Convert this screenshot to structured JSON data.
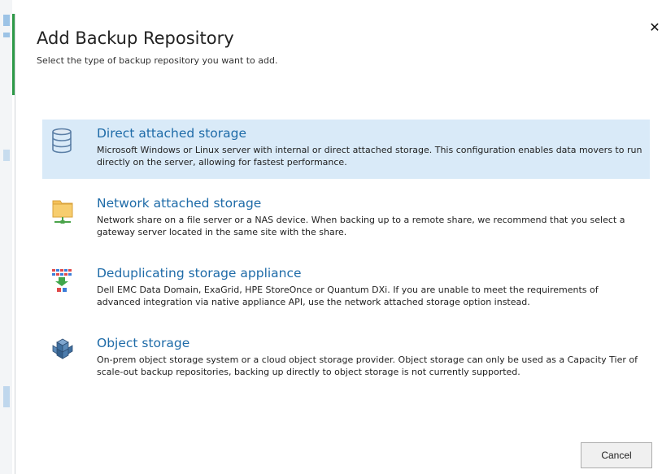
{
  "dialog": {
    "title": "Add Backup Repository",
    "subtitle": "Select the type of backup repository you want to add.",
    "close_glyph": "✕"
  },
  "options": [
    {
      "title": "Direct attached storage",
      "description": "Microsoft Windows or Linux server with internal or direct attached storage. This configuration enables data movers to run directly on the server, allowing for fastest performance.",
      "icon": "database-disk-icon",
      "selected": true
    },
    {
      "title": "Network attached storage",
      "description": "Network share on a file server or a NAS device. When backing up to a remote share, we recommend that you select a gateway server located in the same site with the share.",
      "icon": "network-folder-icon",
      "selected": false
    },
    {
      "title": "Deduplicating storage appliance",
      "description": "Dell EMC Data Domain, ExaGrid, HPE StoreOnce or Quantum DXi. If you are unable to meet the requirements of advanced integration via native appliance API, use the network attached storage option instead.",
      "icon": "dedup-appliance-icon",
      "selected": false
    },
    {
      "title": "Object storage",
      "description": "On-prem object storage system or a cloud object storage provider. Object storage can only be used as a Capacity Tier of scale-out backup repositories, backing up directly to object storage is not currently supported.",
      "icon": "object-storage-cubes-icon",
      "selected": false
    }
  ],
  "footer": {
    "cancel_label": "Cancel"
  },
  "colors": {
    "accent_link": "#1e6ba8",
    "selected_bg": "#d9eaf8",
    "green_accent": "#2e9a48"
  }
}
